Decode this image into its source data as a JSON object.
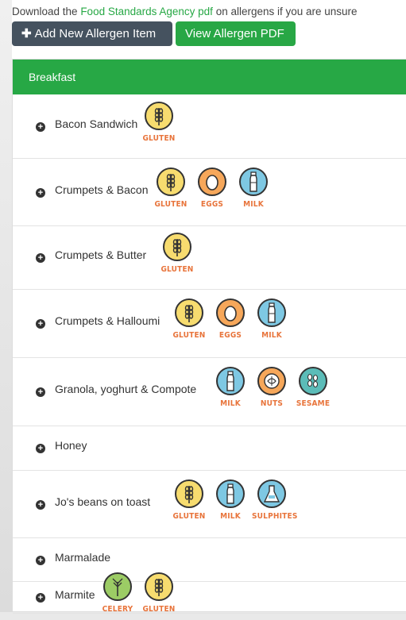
{
  "header": {
    "note_prefix": "Download the ",
    "note_link": "Food Standards Agency pdf",
    "note_suffix": " on allergens if you are unsure",
    "add_button": "Add New Allergen Item",
    "view_button": "View Allergen PDF"
  },
  "section": {
    "title": "Breakfast"
  },
  "items": [
    {
      "name": "Bacon Sandwich",
      "allergens": [
        "GLUTEN"
      ]
    },
    {
      "name": "Crumpets & Bacon",
      "allergens": [
        "GLUTEN",
        "EGGS",
        "MILK"
      ]
    },
    {
      "name": "Crumpets & Butter",
      "allergens": [
        "GLUTEN"
      ]
    },
    {
      "name": "Crumpets & Halloumi",
      "allergens": [
        "GLUTEN",
        "EGGS",
        "MILK"
      ]
    },
    {
      "name": "Granola, yoghurt & Compote",
      "allergens": [
        "MILK",
        "NUTS",
        "SESAME"
      ]
    },
    {
      "name": "Honey",
      "allergens": []
    },
    {
      "name": "Jo's beans on toast",
      "allergens": [
        "GLUTEN",
        "MILK",
        "SULPHITES"
      ]
    },
    {
      "name": "Marmalade",
      "allergens": []
    },
    {
      "name": "Marmite",
      "allergens": [
        "CELERY",
        "GLUTEN"
      ]
    }
  ]
}
